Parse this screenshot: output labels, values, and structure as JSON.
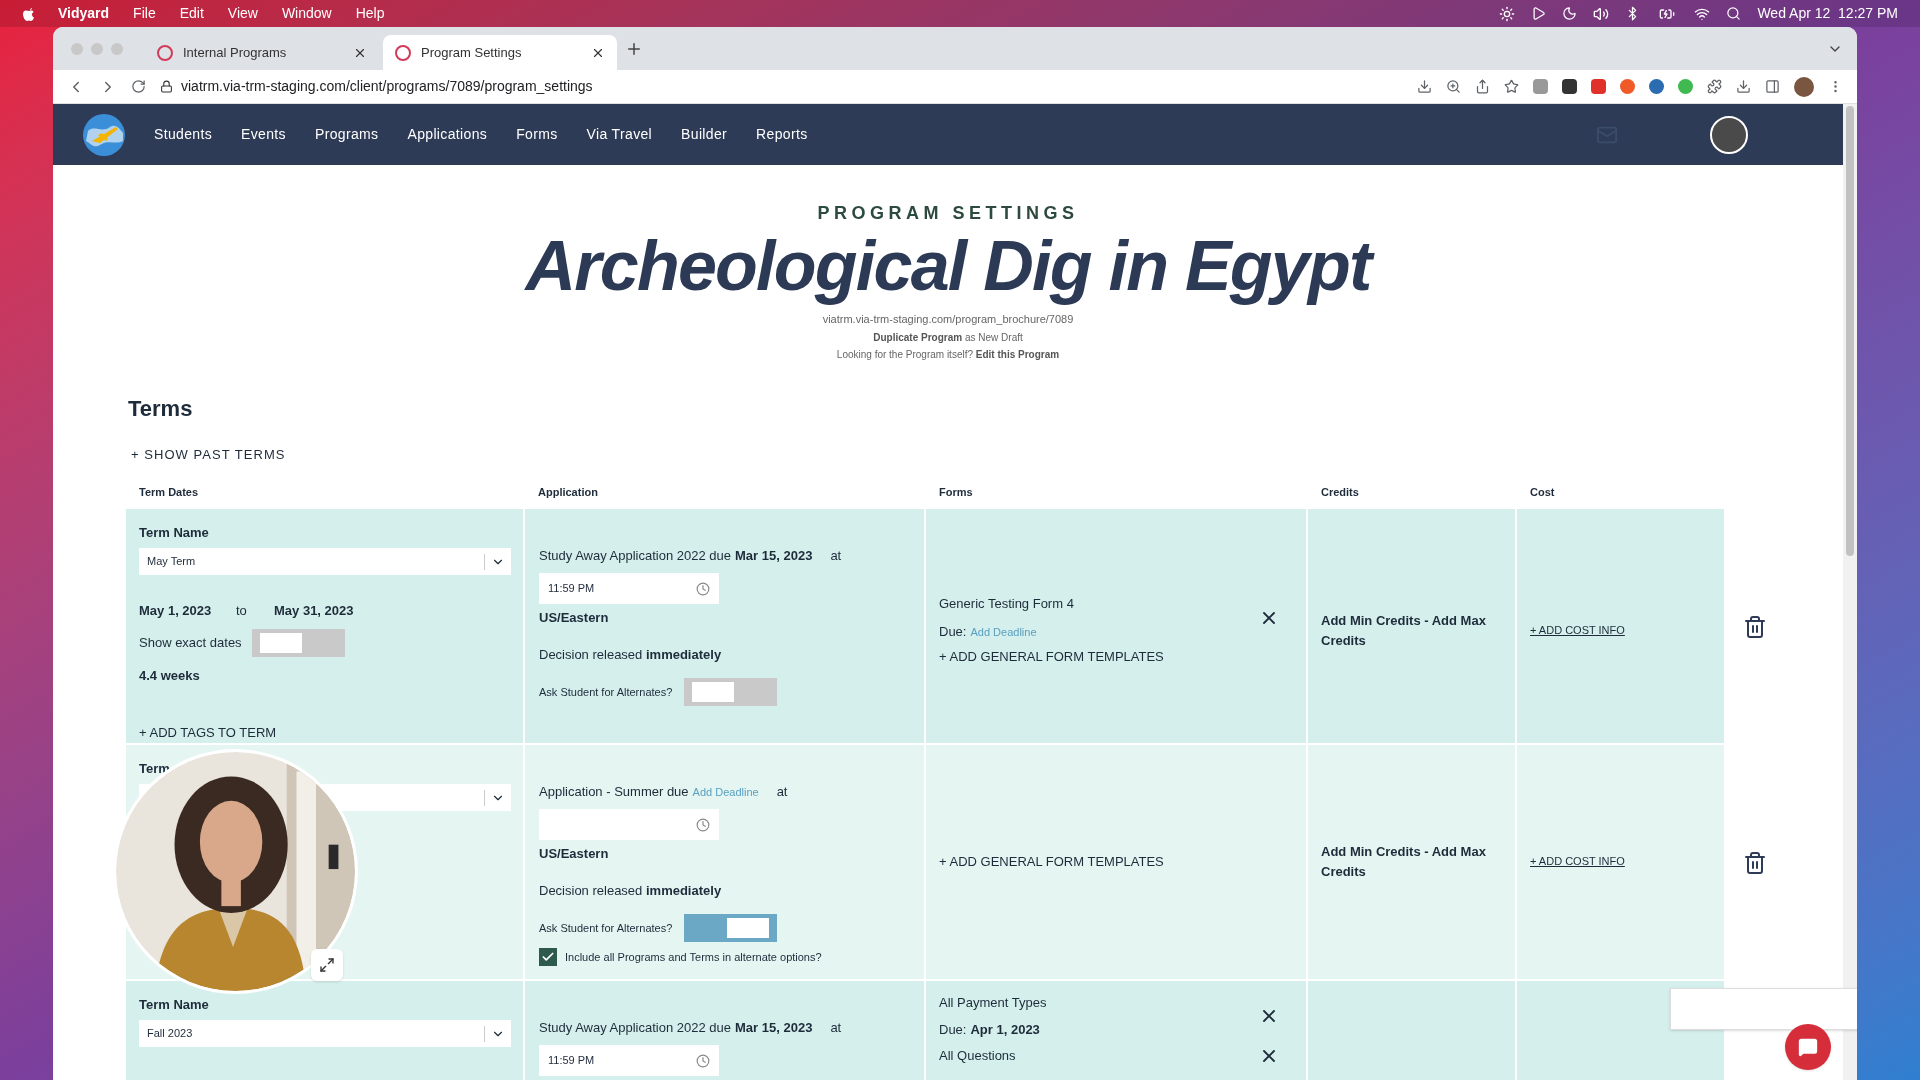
{
  "menubar": {
    "app": "Vidyard",
    "menus": [
      "File",
      "Edit",
      "View",
      "Window",
      "Help"
    ],
    "clock": "Wed Apr 12  12:27 PM"
  },
  "browser": {
    "tabs": [
      {
        "title": "Internal Programs",
        "selected": false
      },
      {
        "title": "Program Settings",
        "selected": true
      }
    ],
    "url": "viatrm.via-trm-staging.com/client/programs/7089/program_settings"
  },
  "nav": {
    "items": [
      "Students",
      "Events",
      "Programs",
      "Applications",
      "Forms",
      "Via Travel",
      "Builder",
      "Reports"
    ]
  },
  "header": {
    "eyebrow": "PROGRAM SETTINGS",
    "title": "Archeological Dig in Egypt",
    "brochure_url": "viatrm.via-trm-staging.com/program_brochure/7089",
    "duplicate_link": "Duplicate Program",
    "duplicate_rest": "as New Draft",
    "edit_prompt": "Looking for the Program itself?",
    "edit_link": "Edit this Program"
  },
  "terms": {
    "title": "Terms",
    "show_past": "+ SHOW PAST TERMS",
    "columns": [
      "Term Dates",
      "Application",
      "Forms",
      "Credits",
      "Cost"
    ],
    "rows": [
      {
        "term": {
          "label": "Term Name",
          "value": "May Term",
          "start": "May 1, 2023",
          "to": "to",
          "end": "May 31, 2023",
          "exact_label": "Show exact dates",
          "exact_on": false,
          "duration": "4.4 weeks",
          "add_tags": "+ ADD TAGS TO TERM"
        },
        "application": {
          "text": "Study Away Application 2022 due",
          "due": "Mar 15, 2023",
          "due_is_link": false,
          "at": "at",
          "time": "11:59 PM",
          "timezone": "US/Eastern",
          "decision": "Decision released",
          "decision_value": "immediately",
          "alternates_label": "Ask Student for Alternates?",
          "alternates_on": false
        },
        "forms": {
          "items": [
            {
              "name": "Generic Testing Form 4",
              "due_label": "Due:",
              "due": "Add Deadline",
              "due_is_link": true
            }
          ],
          "add": "+ ADD GENERAL FORM TEMPLATES"
        },
        "credits": "Add Min Credits - Add Max Credits",
        "cost": "+ ADD COST INFO"
      },
      {
        "term": {
          "label": "Term"
        },
        "application": {
          "text": "Application - Summer due",
          "due": "Add Deadline",
          "due_is_link": true,
          "at": "at",
          "timezone": "US/Eastern",
          "decision": "Decision released",
          "decision_value": "immediately",
          "alternates_label": "Ask Student for Alternates?",
          "alternates_on": true,
          "include_all": {
            "label": "Include all Programs and Terms in alternate options?",
            "checked": true
          }
        },
        "forms": {
          "add": "+ ADD GENERAL FORM TEMPLATES"
        },
        "credits": "Add Min Credits - Add Max Credits",
        "cost": "+ ADD COST INFO"
      },
      {
        "term": {
          "label": "Term Name",
          "value": "Fall 2023"
        },
        "application": {
          "text": "Study Away Application 2022 due",
          "due": "Mar 15, 2023",
          "due_is_link": false,
          "at": "at",
          "time": "11:59 PM"
        },
        "forms": {
          "items": [
            {
              "name": "All Payment Types",
              "due_label": "Due:",
              "due": "Apr 1, 2023",
              "due_is_link": false
            },
            {
              "name": "All Questions"
            }
          ]
        }
      }
    ]
  }
}
